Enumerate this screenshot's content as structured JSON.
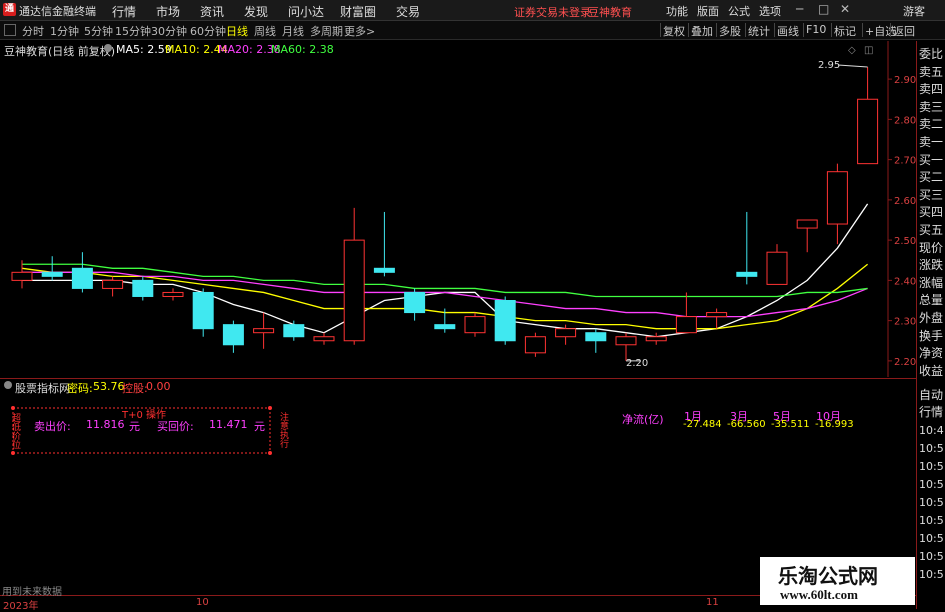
{
  "menu": {
    "app_name": "通达信金融终端",
    "items": [
      "行情",
      "市场",
      "资讯",
      "发现",
      "问小达",
      "财富圈",
      "交易"
    ],
    "notice": "证券交易未登录",
    "brand": "豆神教育",
    "right": [
      "功能",
      "版面",
      "公式",
      "选项"
    ],
    "guest": "游客"
  },
  "periods": {
    "items": [
      "分时",
      "1分钟",
      "5分钟",
      "15分钟",
      "30分钟",
      "60分钟",
      "日线",
      "周线",
      "月线",
      "多周期",
      "更多>"
    ],
    "active_index": 6
  },
  "toolbar": [
    "复权",
    "叠加",
    "多股",
    "统计",
    "画线",
    "F10",
    "标记",
    "+自选",
    "返回"
  ],
  "chart_header": {
    "title": "豆神教育(日线 前复权)",
    "ma": [
      {
        "label": "MA5: 2.59",
        "color": "#ffffff"
      },
      {
        "label": "MA10: 2.44",
        "color": "#ffff00"
      },
      {
        "label": "MA20: 2.38",
        "color": "#ff40ff"
      },
      {
        "label": "MA60: 2.38",
        "color": "#40ff40"
      }
    ]
  },
  "chart_data": {
    "type": "candlestick",
    "price_axis": {
      "min": 2.15,
      "max": 2.95,
      "ticks": [
        "2.90",
        "2.80",
        "2.70",
        "2.60",
        "2.50",
        "2.40",
        "2.30",
        "2.20"
      ]
    },
    "annotations": {
      "high": "2.95",
      "low": "2.20"
    },
    "candles": [
      {
        "o": 2.4,
        "h": 2.45,
        "l": 2.38,
        "c": 2.42
      },
      {
        "o": 2.42,
        "h": 2.46,
        "l": 2.4,
        "c": 2.41
      },
      {
        "o": 2.43,
        "h": 2.47,
        "l": 2.37,
        "c": 2.38
      },
      {
        "o": 2.38,
        "h": 2.41,
        "l": 2.36,
        "c": 2.4
      },
      {
        "o": 2.4,
        "h": 2.41,
        "l": 2.35,
        "c": 2.36
      },
      {
        "o": 2.36,
        "h": 2.38,
        "l": 2.35,
        "c": 2.37
      },
      {
        "o": 2.37,
        "h": 2.38,
        "l": 2.26,
        "c": 2.28
      },
      {
        "o": 2.29,
        "h": 2.3,
        "l": 2.22,
        "c": 2.24
      },
      {
        "o": 2.27,
        "h": 2.32,
        "l": 2.23,
        "c": 2.28
      },
      {
        "o": 2.29,
        "h": 2.3,
        "l": 2.25,
        "c": 2.26
      },
      {
        "o": 2.25,
        "h": 2.27,
        "l": 2.24,
        "c": 2.26
      },
      {
        "o": 2.25,
        "h": 2.58,
        "l": 2.24,
        "c": 2.5
      },
      {
        "o": 2.43,
        "h": 2.57,
        "l": 2.41,
        "c": 2.42
      },
      {
        "o": 2.37,
        "h": 2.38,
        "l": 2.3,
        "c": 2.32
      },
      {
        "o": 2.29,
        "h": 2.33,
        "l": 2.27,
        "c": 2.28
      },
      {
        "o": 2.27,
        "h": 2.32,
        "l": 2.26,
        "c": 2.31
      },
      {
        "o": 2.35,
        "h": 2.36,
        "l": 2.24,
        "c": 2.25
      },
      {
        "o": 2.22,
        "h": 2.27,
        "l": 2.21,
        "c": 2.26
      },
      {
        "o": 2.26,
        "h": 2.29,
        "l": 2.24,
        "c": 2.28
      },
      {
        "o": 2.27,
        "h": 2.28,
        "l": 2.22,
        "c": 2.25
      },
      {
        "o": 2.24,
        "h": 2.27,
        "l": 2.2,
        "c": 2.26
      },
      {
        "o": 2.25,
        "h": 2.27,
        "l": 2.24,
        "c": 2.26
      },
      {
        "o": 2.27,
        "h": 2.37,
        "l": 2.27,
        "c": 2.31
      },
      {
        "o": 2.31,
        "h": 2.33,
        "l": 2.28,
        "c": 2.32
      },
      {
        "o": 2.42,
        "h": 2.57,
        "l": 2.39,
        "c": 2.41
      },
      {
        "o": 2.39,
        "h": 2.49,
        "l": 2.39,
        "c": 2.47
      },
      {
        "o": 2.53,
        "h": 2.55,
        "l": 2.47,
        "c": 2.55
      },
      {
        "o": 2.54,
        "h": 2.69,
        "l": 2.49,
        "c": 2.67
      },
      {
        "o": 2.69,
        "h": 2.93,
        "l": 2.69,
        "c": 2.85
      }
    ],
    "ma_lines": [
      {
        "name": "MA5",
        "color": "#ffffff",
        "values": [
          2.4,
          2.4,
          2.4,
          2.4,
          2.39,
          2.39,
          2.37,
          2.34,
          2.32,
          2.29,
          2.27,
          2.31,
          2.35,
          2.36,
          2.37,
          2.37,
          2.3,
          2.29,
          2.28,
          2.28,
          2.27,
          2.26,
          2.27,
          2.28,
          2.31,
          2.35,
          2.4,
          2.48,
          2.59
        ]
      },
      {
        "name": "MA10",
        "color": "#ffff00",
        "values": [
          2.43,
          2.42,
          2.42,
          2.41,
          2.41,
          2.4,
          2.39,
          2.38,
          2.37,
          2.35,
          2.33,
          2.33,
          2.33,
          2.33,
          2.32,
          2.32,
          2.31,
          2.3,
          2.3,
          2.29,
          2.29,
          2.28,
          2.28,
          2.28,
          2.29,
          2.3,
          2.33,
          2.38,
          2.44
        ]
      },
      {
        "name": "MA20",
        "color": "#ff40ff",
        "values": [
          2.42,
          2.42,
          2.42,
          2.42,
          2.41,
          2.41,
          2.4,
          2.4,
          2.39,
          2.38,
          2.37,
          2.37,
          2.37,
          2.37,
          2.37,
          2.36,
          2.35,
          2.34,
          2.33,
          2.33,
          2.32,
          2.32,
          2.31,
          2.31,
          2.31,
          2.32,
          2.33,
          2.35,
          2.38
        ]
      },
      {
        "name": "MA60",
        "color": "#40ff40",
        "values": [
          2.44,
          2.44,
          2.44,
          2.43,
          2.43,
          2.42,
          2.41,
          2.41,
          2.4,
          2.4,
          2.39,
          2.39,
          2.39,
          2.38,
          2.38,
          2.38,
          2.37,
          2.37,
          2.37,
          2.36,
          2.36,
          2.36,
          2.36,
          2.36,
          2.36,
          2.36,
          2.37,
          2.37,
          2.38
        ]
      }
    ]
  },
  "right_panel": {
    "quote_labels": [
      "委比",
      "卖五",
      "卖四",
      "卖三",
      "卖二",
      "卖一",
      "买一",
      "买二",
      "买三",
      "买四",
      "买五",
      "现价",
      "涨跌",
      "涨幅",
      "总量",
      "外盘",
      "换手",
      "净资",
      "收益"
    ],
    "lower": [
      "自动",
      "行情"
    ],
    "times": [
      "10:4",
      "10:5",
      "10:5",
      "10:5",
      "10:5",
      "10:5",
      "10:5",
      "10:5",
      "10:5"
    ]
  },
  "indicator": {
    "name": "股票指标网",
    "pwd_label": "密码:",
    "pwd_value": "53.76",
    "ctrl_label": "控股:",
    "ctrl_value": "0.00",
    "box_title": "T+0 操作",
    "left_vertical": "超低价位",
    "sell_label": "卖出价:",
    "sell_value": "11.816",
    "unit": "元",
    "buy_label": "买回价:",
    "buy_value": "11.471",
    "right_vertical": "注意执行",
    "net_label": "净流(亿)",
    "months": [
      "1月",
      "3月",
      "5月",
      "10月"
    ],
    "flows": [
      "-27.484",
      "-66.560",
      "-35.511",
      "-16.993"
    ]
  },
  "footer": {
    "note": "用到未来数据",
    "year": "2023年",
    "month_marks": [
      "10",
      "11"
    ]
  },
  "watermark": {
    "title": "乐淘公式网",
    "url": "www.60lt.com"
  }
}
